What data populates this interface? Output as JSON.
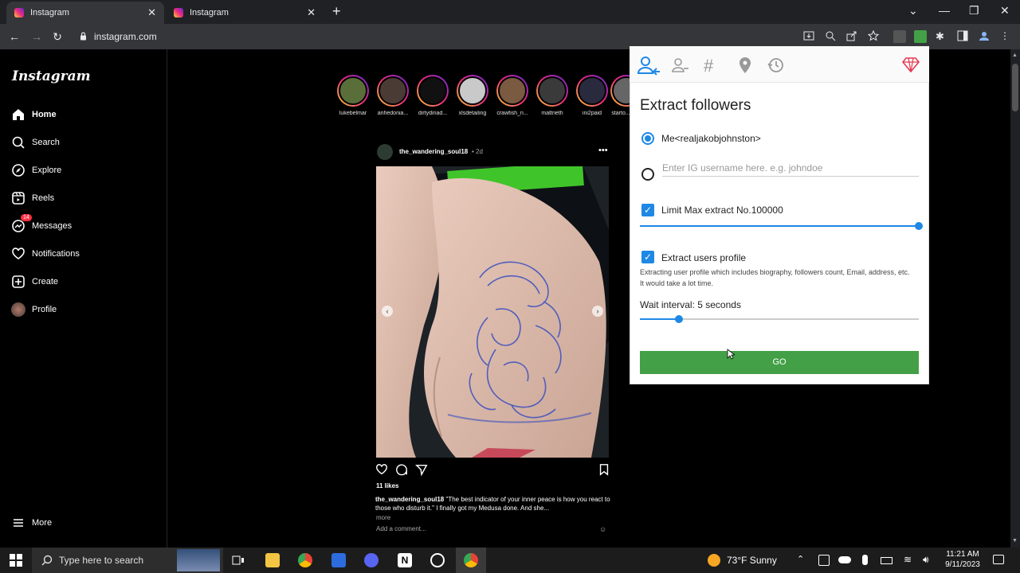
{
  "browser": {
    "tabs": [
      {
        "title": "Instagram"
      },
      {
        "title": "Instagram"
      }
    ],
    "new_tab": "+",
    "url": "instagram.com"
  },
  "instagram": {
    "logo": "Instagram",
    "nav": [
      {
        "label": "Home",
        "icon": "home-icon"
      },
      {
        "label": "Search",
        "icon": "search-icon"
      },
      {
        "label": "Explore",
        "icon": "explore-icon"
      },
      {
        "label": "Reels",
        "icon": "reels-icon"
      },
      {
        "label": "Messages",
        "icon": "messages-icon",
        "badge": "14"
      },
      {
        "label": "Notifications",
        "icon": "heart-icon"
      },
      {
        "label": "Create",
        "icon": "create-icon"
      },
      {
        "label": "Profile",
        "icon": "avatar"
      }
    ],
    "more": "More",
    "stories": [
      {
        "name": "lukebelmar"
      },
      {
        "name": "anhedonia..."
      },
      {
        "name": "dirtydinad..."
      },
      {
        "name": "xlsdetailing"
      },
      {
        "name": "crawfish_ri..."
      },
      {
        "name": "mattrieth"
      },
      {
        "name": "ini2paid"
      },
      {
        "name": "starto..."
      }
    ],
    "post": {
      "username": "the_wandering_soul18",
      "time": "• 2d",
      "likes": "11 likes",
      "caption_user": "the_wandering_soul18",
      "caption_text": "\"The best indicator of your inner peace is how you react to those who disturb it.\" I finally got my Medusa done. And she...",
      "more": "more",
      "add_comment": "Add a comment..."
    }
  },
  "extension": {
    "title": "Extract followers",
    "tabs": [
      "add-user-icon",
      "user-icon",
      "hashtag-icon",
      "location-icon",
      "history-icon",
      "diamond-icon"
    ],
    "option_me": "Me<realjakobjohnston>",
    "input_placeholder": "Enter IG username here. e.g. johndoe",
    "limit_label": "Limit Max extract No.100000",
    "limit_value_fraction": 1.0,
    "extract_profile_label": "Extract users profile",
    "extract_profile_desc": "Extracting user profile which includes biography, followers count, Email, address, etc. It would take a lot time.",
    "wait_label": "Wait interval: 5 seconds",
    "wait_value_fraction": 0.14,
    "go_button": "GO",
    "accent": "#1e88e5",
    "go_color": "#43a047"
  },
  "taskbar": {
    "search_placeholder": "Type here to search",
    "weather": "73°F  Sunny",
    "time": "11:21 AM",
    "date": "9/11/2023"
  }
}
